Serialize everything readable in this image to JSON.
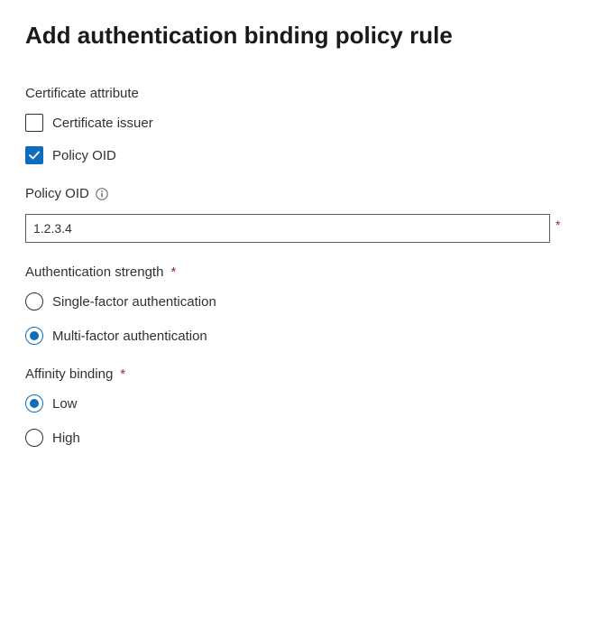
{
  "page_title": "Add authentication binding policy rule",
  "certificate_attribute": {
    "label": "Certificate attribute",
    "options": [
      {
        "label": "Certificate issuer",
        "checked": false
      },
      {
        "label": "Policy OID",
        "checked": true
      }
    ]
  },
  "policy_oid": {
    "label": "Policy OID",
    "value": "1.2.3.4",
    "required": true
  },
  "authentication_strength": {
    "label": "Authentication strength",
    "required": true,
    "options": [
      {
        "label": "Single-factor authentication",
        "selected": false
      },
      {
        "label": "Multi-factor authentication",
        "selected": true
      }
    ]
  },
  "affinity_binding": {
    "label": "Affinity binding",
    "required": true,
    "options": [
      {
        "label": "Low",
        "selected": true
      },
      {
        "label": "High",
        "selected": false
      }
    ]
  }
}
